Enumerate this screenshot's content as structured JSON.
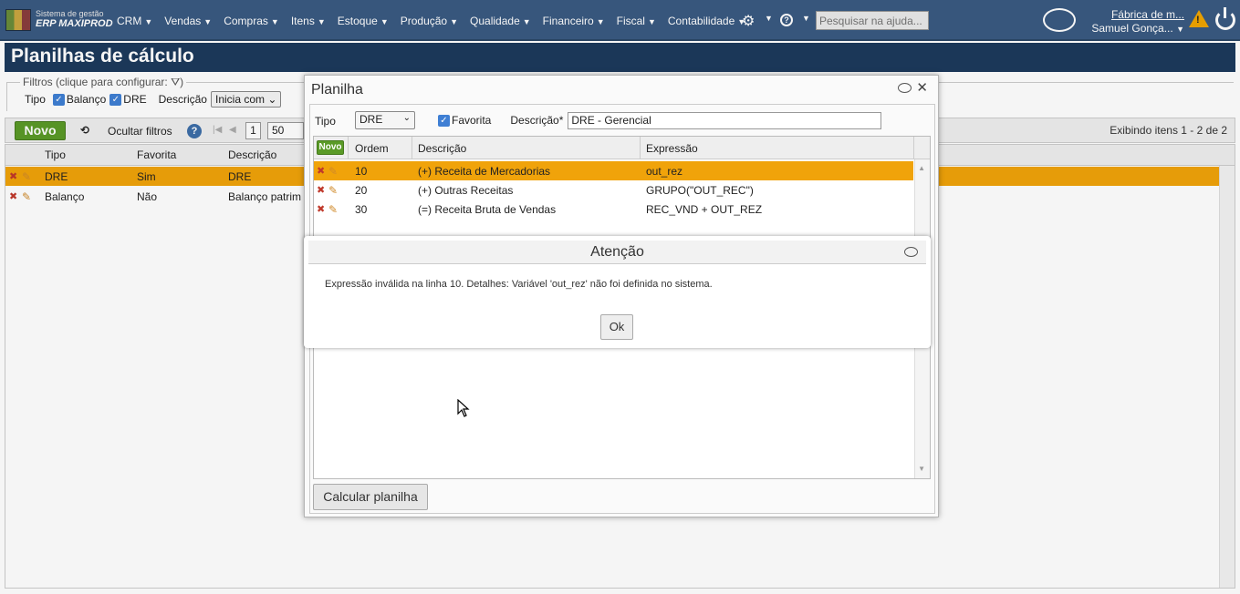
{
  "brand": {
    "line1": "Sistema de gestão",
    "line2": "ERP MAXIPROD"
  },
  "menu": [
    {
      "label": "CRM"
    },
    {
      "label": "Vendas"
    },
    {
      "label": "Compras"
    },
    {
      "label": "Itens"
    },
    {
      "label": "Estoque"
    },
    {
      "label": "Produção"
    },
    {
      "label": "Qualidade"
    },
    {
      "label": "Financeiro"
    },
    {
      "label": "Fiscal"
    },
    {
      "label": "Contabilidade"
    }
  ],
  "help_search": {
    "placeholder": "Pesquisar na ajuda..."
  },
  "user": {
    "company": "Fábrica de m...",
    "name": "Samuel Gonça..."
  },
  "page": {
    "title": "Planilhas de cálculo"
  },
  "filters": {
    "legend": "Filtros (clique para configurar:",
    "tipo_label": "Tipo",
    "opt1": "Balanço",
    "opt2": "DRE",
    "descricao_label": "Descrição",
    "descricao_mode": "Inicia com"
  },
  "toolbar": {
    "novo": "Novo",
    "ocultar": "Ocultar filtros",
    "page": "1",
    "page_size": "50",
    "exibindo": "Exibindo itens 1 - 2 de 2"
  },
  "grid": {
    "headers": {
      "tipo": "Tipo",
      "favorita": "Favorita",
      "descricao": "Descrição"
    },
    "rows": [
      {
        "tipo": "DRE",
        "favorita": "Sim",
        "descricao": "DRE"
      },
      {
        "tipo": "Balanço",
        "favorita": "Não",
        "descricao": "Balanço patrim"
      }
    ]
  },
  "planilha": {
    "title": "Planilha",
    "tipo_label": "Tipo",
    "tipo_value": "DRE",
    "favorita_label": "Favorita",
    "descricao_label": "Descrição*",
    "descricao_value": "DRE - Gerencial",
    "novo": "Novo",
    "headers": {
      "ordem": "Ordem",
      "descricao": "Descrição",
      "expressao": "Expressão"
    },
    "rows": [
      {
        "ordem": "10",
        "descricao": "(+) Receita de Mercadorias",
        "expressao": "out_rez"
      },
      {
        "ordem": "20",
        "descricao": "(+) Outras Receitas",
        "expressao": "GRUPO(\"OUT_REC\")"
      },
      {
        "ordem": "30",
        "descricao": "(=) Receita Bruta de Vendas",
        "expressao": "REC_VND + OUT_REZ"
      }
    ],
    "calc_button": "Calcular planilha"
  },
  "atencao": {
    "title": "Atenção",
    "message": "Expressão inválida na linha 10. Detalhes: Variável 'out_rez' não foi definida no sistema.",
    "ok": "Ok"
  },
  "colors": {
    "nav": "#3a5a82",
    "title_bar": "#1d3a5c",
    "selected_row": "#f0a30a",
    "green_button": "#5a9a27"
  }
}
